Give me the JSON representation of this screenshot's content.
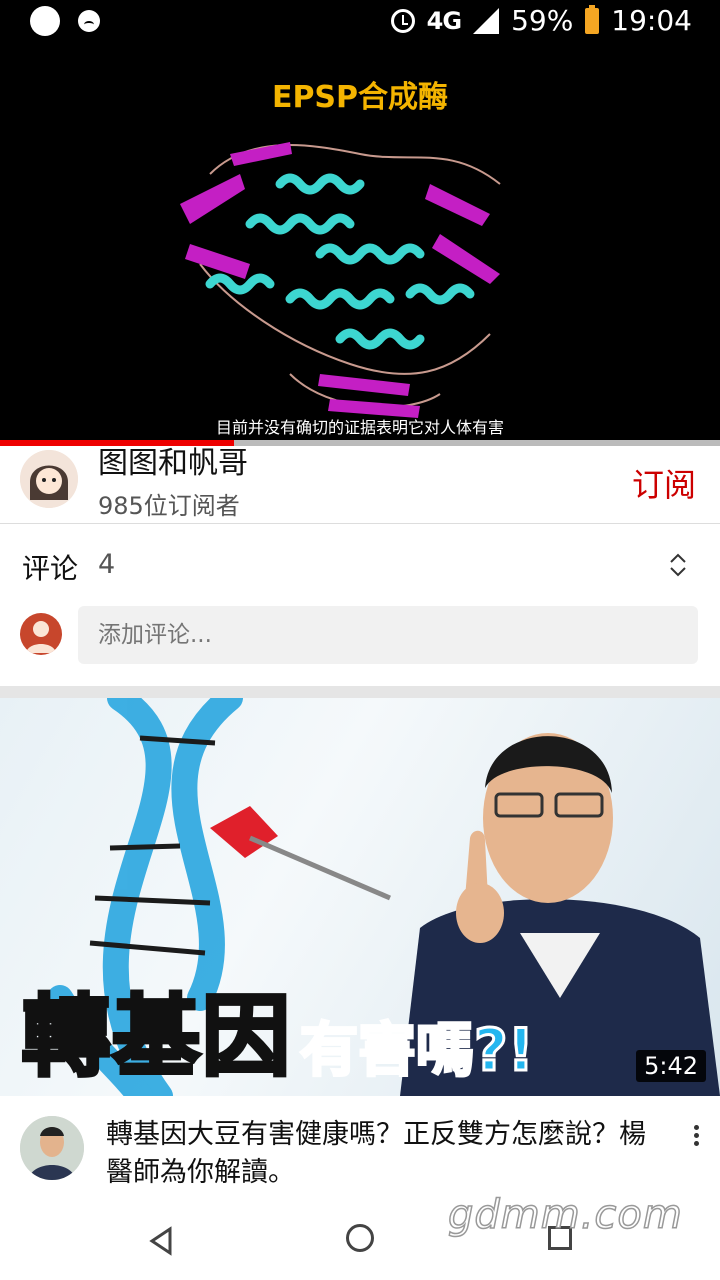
{
  "status_bar": {
    "network": "4G",
    "battery": "59%",
    "time": "19:04",
    "icons": [
      "circle-icon",
      "face-icon",
      "alarm-icon",
      "signal-icon",
      "battery-icon"
    ]
  },
  "video": {
    "title_overlay": "EPSP合成酶",
    "subtitle": "目前并没有确切的证据表明它对人体有害",
    "progress_fraction": 0.325
  },
  "channel": {
    "name": "图图和帆哥",
    "subscribers": "985位订阅者",
    "subscribe_label": "订阅"
  },
  "comments": {
    "label": "评论",
    "count": "4",
    "placeholder": "添加评论..."
  },
  "recommended": {
    "thumb_text_main": "轉基因",
    "thumb_text_sub": "有害嗎?!",
    "duration": "5:42",
    "title": "轉基因大豆有害健康嗎？正反雙方怎麼說？楊醫師為你解讀。"
  },
  "watermark": "gdmm.com",
  "colors": {
    "accent_red": "#cc0000",
    "title_yellow": "#f4b400",
    "helix_cyan": "#3dd6d0",
    "sheet_magenta": "#c41fc4"
  }
}
